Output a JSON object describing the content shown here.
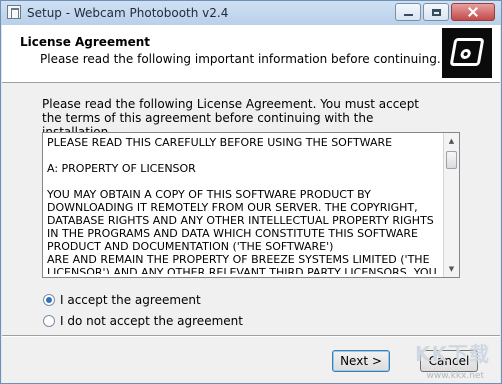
{
  "window": {
    "title": "Setup - Webcam Photobooth v2.4"
  },
  "header": {
    "title": "License Agreement",
    "subtitle": "Please read the following important information before continuing."
  },
  "intro": "Please read the following License Agreement. You must accept the terms of this agreement before continuing with the installation.",
  "license": {
    "text": "PLEASE READ THIS CAREFULLY BEFORE USING THE SOFTWARE\n\nA: PROPERTY OF LICENSOR\n\nYOU MAY OBTAIN A COPY OF THIS SOFTWARE PRODUCT BY DOWNLOADING IT REMOTELY FROM OUR SERVER. THE COPYRIGHT, DATABASE RIGHTS AND ANY OTHER INTELLECTUAL PROPERTY RIGHTS IN THE PROGRAMS AND DATA WHICH CONSTITUTE THIS SOFTWARE PRODUCT AND DOCUMENTATION ('THE SOFTWARE')\nARE AND REMAIN THE PROPERTY OF BREEZE SYSTEMS LIMITED ('THE LICENSOR') AND ANY OTHER RELEVANT THIRD PARTY LICENSORS. YOU ARE"
  },
  "options": {
    "accept": "I accept the agreement",
    "decline": "I do not accept the agreement",
    "selected": "accept"
  },
  "buttons": {
    "next": "Next >",
    "cancel": "Cancel"
  },
  "watermark": {
    "brand": "KK下载",
    "url": "www.kkx.net"
  }
}
